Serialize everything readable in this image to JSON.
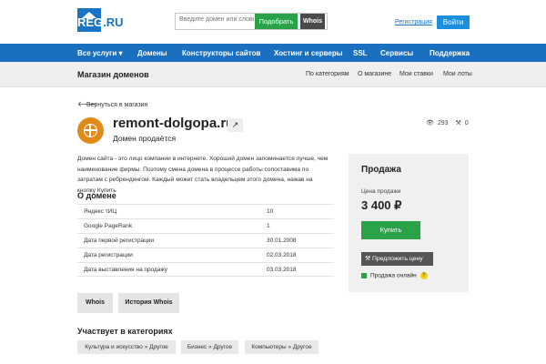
{
  "header": {
    "logo_text": "REG.RU",
    "search": {
      "placeholder": "Введите домен или слово"
    },
    "pick_button": "Подобрать",
    "whois_button": "Whois",
    "register_link": "Регистрация",
    "login_button": "Войти"
  },
  "nav": {
    "items": [
      "Все услуги ▾",
      "Домены",
      "Конструкторы сайтов",
      "Хостинг и серверы",
      "SSL",
      "Сервисы",
      "Поддержка"
    ]
  },
  "subbar": {
    "title": "Магазин доменов",
    "links": [
      "По категориям",
      "О магазине",
      "Мои ставки",
      "Мои лоты"
    ]
  },
  "back_link": "Вернуться в магазин",
  "domain": {
    "name": "remont-dolgopa.ru",
    "status": "Домен продаётся",
    "views": "293",
    "bids": "0"
  },
  "description": "Домен сайта - это лицо компании в интернете. Хороший домен запоминается лучше, чем наименование фирмы. Поэтому смена домена в процессе работы сопоставима по затратам с ребрендингом. Каждый может стать владельцем этого домена, нажав на кнопку Купить",
  "about": {
    "title": "О домене",
    "rows": [
      {
        "key": "Яндекс тИЦ",
        "value": "10"
      },
      {
        "key": "Google PageRank",
        "value": "1"
      },
      {
        "key": "Дата первой регистрации",
        "value": "30.01.2008"
      },
      {
        "key": "Дата регистрации",
        "value": "02.03.2018"
      },
      {
        "key": "Дата выставления на продажу",
        "value": "03.03.2018"
      }
    ]
  },
  "actions": {
    "whois": "Whois",
    "history": "История Whois"
  },
  "categories": {
    "title": "Участвует в категориях",
    "items": [
      "Культура и искусство » Другое",
      "Бизнес » Другое",
      "Компьютеры » Другое"
    ]
  },
  "sale": {
    "title": "Продажа",
    "price_label": "Цена продажи",
    "price": "3 400 ₽",
    "buy_button": "Купить",
    "offer_button": "Предложить цену",
    "online_label": "Продажа онлайн"
  },
  "colors": {
    "brand": "#1a6fbf",
    "green": "#2aa24a",
    "icon_orange": "#e08a1a"
  }
}
